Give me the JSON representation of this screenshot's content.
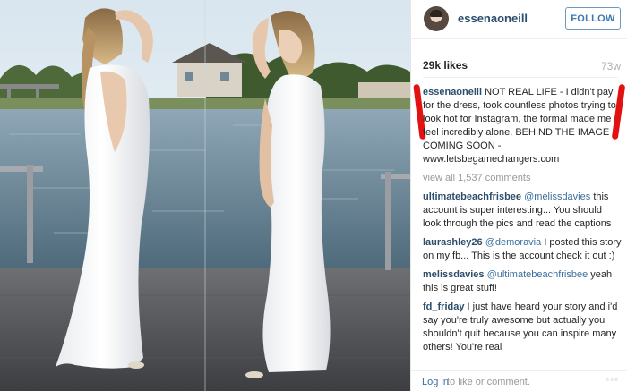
{
  "header": {
    "username": "essenaoneill",
    "follow_label": "FOLLOW"
  },
  "stats": {
    "likes": "29k likes",
    "age": "73w"
  },
  "caption": {
    "user": "essenaoneill",
    "text": "NOT REAL LIFE - I didn't pay for the dress, took countless photos trying to look hot for Instagram, the formal made me feel incredibly alone. BEHIND THE IMAGE COMING SOON - www.letsbegamechangers.com"
  },
  "view_all": "view all 1,537 comments",
  "comments": [
    {
      "user": "ultimatebeachfrisbee",
      "mention": "@melissdavies",
      "text": "this account is super interesting... You should look through the pics and read the captions"
    },
    {
      "user": "laurashley26",
      "mention": "@demoravia",
      "text": "I posted this story on my fb... This is the account check it out :)"
    },
    {
      "user": "melissdavies",
      "mention": "@ultimatebeachfrisbee",
      "text": "yeah this is great stuff!"
    },
    {
      "user": "fd_friday",
      "mention": "",
      "text": "I just have heard your story and i'd say you're truly awesome but actually you shouldn't quit because you can inspire many others! You're real"
    }
  ],
  "footer": {
    "login_link": "Log in",
    "login_text": "to like or comment.",
    "more_icon": "ellipsis-icon"
  },
  "colors": {
    "username": "#2c4d6b",
    "link": "#3b6f9e",
    "follow_border": "#6a98c0",
    "annotation_red": "#e21212"
  }
}
